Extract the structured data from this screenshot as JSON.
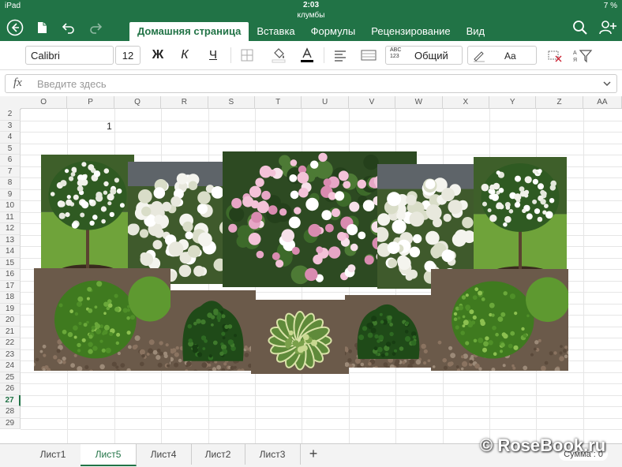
{
  "status": {
    "carrier": "iPad",
    "time": "2:03",
    "battery": "7 %"
  },
  "document": {
    "name": "клумбы"
  },
  "tabs": [
    {
      "label": "Домашняя страница",
      "active": true
    },
    {
      "label": "Вставка",
      "active": false
    },
    {
      "label": "Формулы",
      "active": false
    },
    {
      "label": "Рецензирование",
      "active": false
    },
    {
      "label": "Вид",
      "active": false
    }
  ],
  "toolbar": {
    "font_name": "Calibri",
    "font_size": "12",
    "bold": "Ж",
    "italic": "К",
    "underline": "Ч",
    "number_format_icon": "ABC\n123",
    "number_format": "Общий",
    "cell_styles": "Aa"
  },
  "formula_bar": {
    "fx": "fx",
    "placeholder": "Введите здесь"
  },
  "columns": [
    "O",
    "P",
    "Q",
    "R",
    "S",
    "T",
    "U",
    "V",
    "W",
    "X",
    "Y",
    "Z",
    "AA"
  ],
  "rows": [
    "2",
    "3",
    "4",
    "5",
    "6",
    "7",
    "8",
    "9",
    "10",
    "11",
    "12",
    "13",
    "14",
    "15",
    "16",
    "17",
    "18",
    "19",
    "20",
    "21",
    "22",
    "23",
    "24",
    "25",
    "26",
    "27",
    "28",
    "29"
  ],
  "selected_row": "27",
  "cells": {
    "P3": "1"
  },
  "sheets": [
    {
      "label": "Лист1",
      "active": false
    },
    {
      "label": "Лист5",
      "active": true
    },
    {
      "label": "Лист4",
      "active": false
    },
    {
      "label": "Лист2",
      "active": false
    },
    {
      "label": "Лист3",
      "active": false
    }
  ],
  "sum": "Сумма : 0",
  "watermark": "© RoseBook.ru",
  "colors": {
    "accent": "#217346",
    "pink": "#e7a6c6",
    "white_flower": "#f4f4ee",
    "conifer": "#3f7a1f",
    "grass": "#6fa33a"
  }
}
